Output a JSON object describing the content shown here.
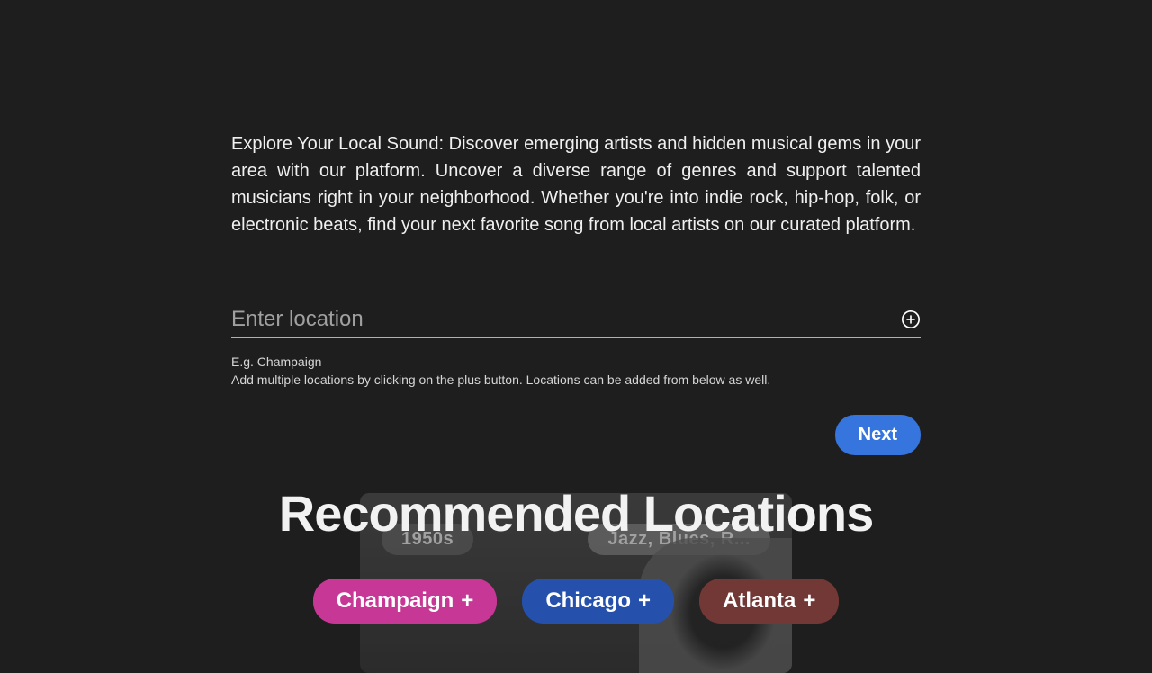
{
  "intro": {
    "text": "Explore Your Local Sound: Discover emerging artists and hidden musical gems in your area with our platform. Uncover a diverse range of genres and support talented musicians right in your neighborhood. Whether you're into indie rock, hip-hop, folk, or electronic beats, find your next favorite song from local artists on our curated platform."
  },
  "location_field": {
    "placeholder": "Enter location",
    "value": "",
    "hint_line1": "E.g. Champaign",
    "hint_line2": "Add multiple locations by clicking on the plus button. Locations can be added from below as well."
  },
  "actions": {
    "next_label": "Next"
  },
  "recommended": {
    "title": "Recommended Locations",
    "bg_left_label": "1950s",
    "bg_right_label": "Jazz, Blues, R...",
    "items": [
      {
        "label": "Champaign",
        "color": "pink"
      },
      {
        "label": "Chicago",
        "color": "blue"
      },
      {
        "label": "Atlanta",
        "color": "maroon"
      }
    ]
  }
}
